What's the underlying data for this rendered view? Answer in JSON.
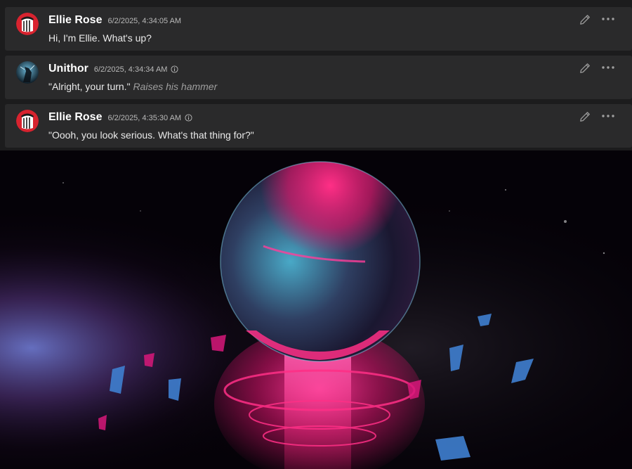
{
  "messages": [
    {
      "author": "Ellie Rose",
      "timestamp": "6/2/2025, 4:34:05 AM",
      "text": "Hi, I'm Ellie. What's up?",
      "action": "",
      "avatar": "ellie-avatar",
      "info_icon": false
    },
    {
      "author": "Unithor",
      "timestamp": "6/2/2025, 4:34:34 AM",
      "text": "\"Alright, your turn.\"",
      "action": "Raises his hammer",
      "avatar": "unithor-avatar",
      "info_icon": true
    },
    {
      "author": "Ellie Rose",
      "timestamp": "6/2/2025, 4:35:30 AM",
      "text": "\"Oooh, you look serious. What's that thing for?\"",
      "action": "",
      "avatar": "ellie-avatar",
      "info_icon": true
    }
  ],
  "icons": {
    "edit": "pencil-icon",
    "more": "more-horizontal-icon",
    "info": "info-icon"
  },
  "colors": {
    "panel_background": "#1c1c1d",
    "message_background": "#2a2a2b",
    "author_text": "#ffffff",
    "timestamp_text": "#b9b9b9",
    "message_text": "#eaeaea",
    "action_text": "#9e9e9e",
    "avatar_red": "#d8232f",
    "neon_pink": "#ff1f7a",
    "neon_cyan": "#3fc6e6"
  },
  "background_image": "neon-crystal-orb-artwork"
}
